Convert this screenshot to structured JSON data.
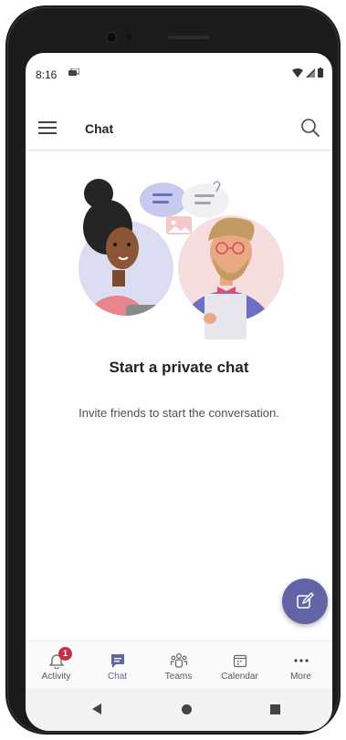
{
  "status": {
    "time": "8:16"
  },
  "appbar": {
    "title": "Chat"
  },
  "empty_state": {
    "headline": "Start a private chat",
    "subtext": "Invite friends to start the conversation."
  },
  "tabs": [
    {
      "label": "Activity",
      "icon": "bell-icon",
      "badge": "1"
    },
    {
      "label": "Chat",
      "icon": "chat-icon",
      "active": true
    },
    {
      "label": "Teams",
      "icon": "teams-icon"
    },
    {
      "label": "Calendar",
      "icon": "calendar-icon"
    },
    {
      "label": "More",
      "icon": "more-icon"
    }
  ],
  "colors": {
    "accent": "#6264a7",
    "badge": "#c4314b"
  }
}
